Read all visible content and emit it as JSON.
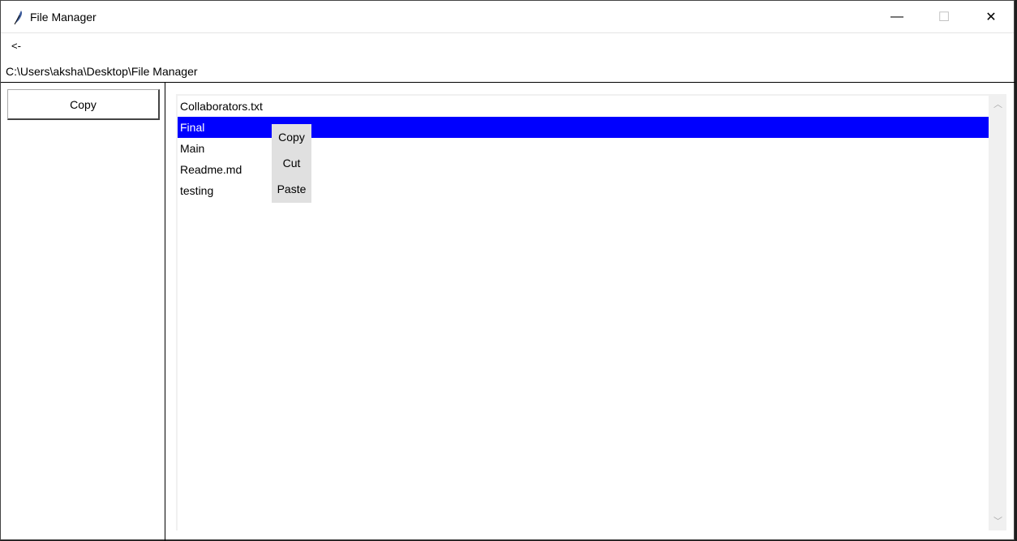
{
  "window": {
    "title": "File Manager",
    "minimize": "—",
    "maximize": "☐",
    "close": "✕"
  },
  "toolbar": {
    "back_label": "<-",
    "path": "C:\\Users\\aksha\\Desktop\\File Manager"
  },
  "sidebar": {
    "copy_label": "Copy"
  },
  "files": [
    "Collaborators.txt",
    "Final",
    "Main",
    "Readme.md",
    "testing"
  ],
  "selected": "Final",
  "context_menu": {
    "items": [
      "Copy",
      "Cut",
      "Paste"
    ]
  },
  "colors": {
    "selection": "#0000ff",
    "menu_bg": "#e0e0e0"
  }
}
